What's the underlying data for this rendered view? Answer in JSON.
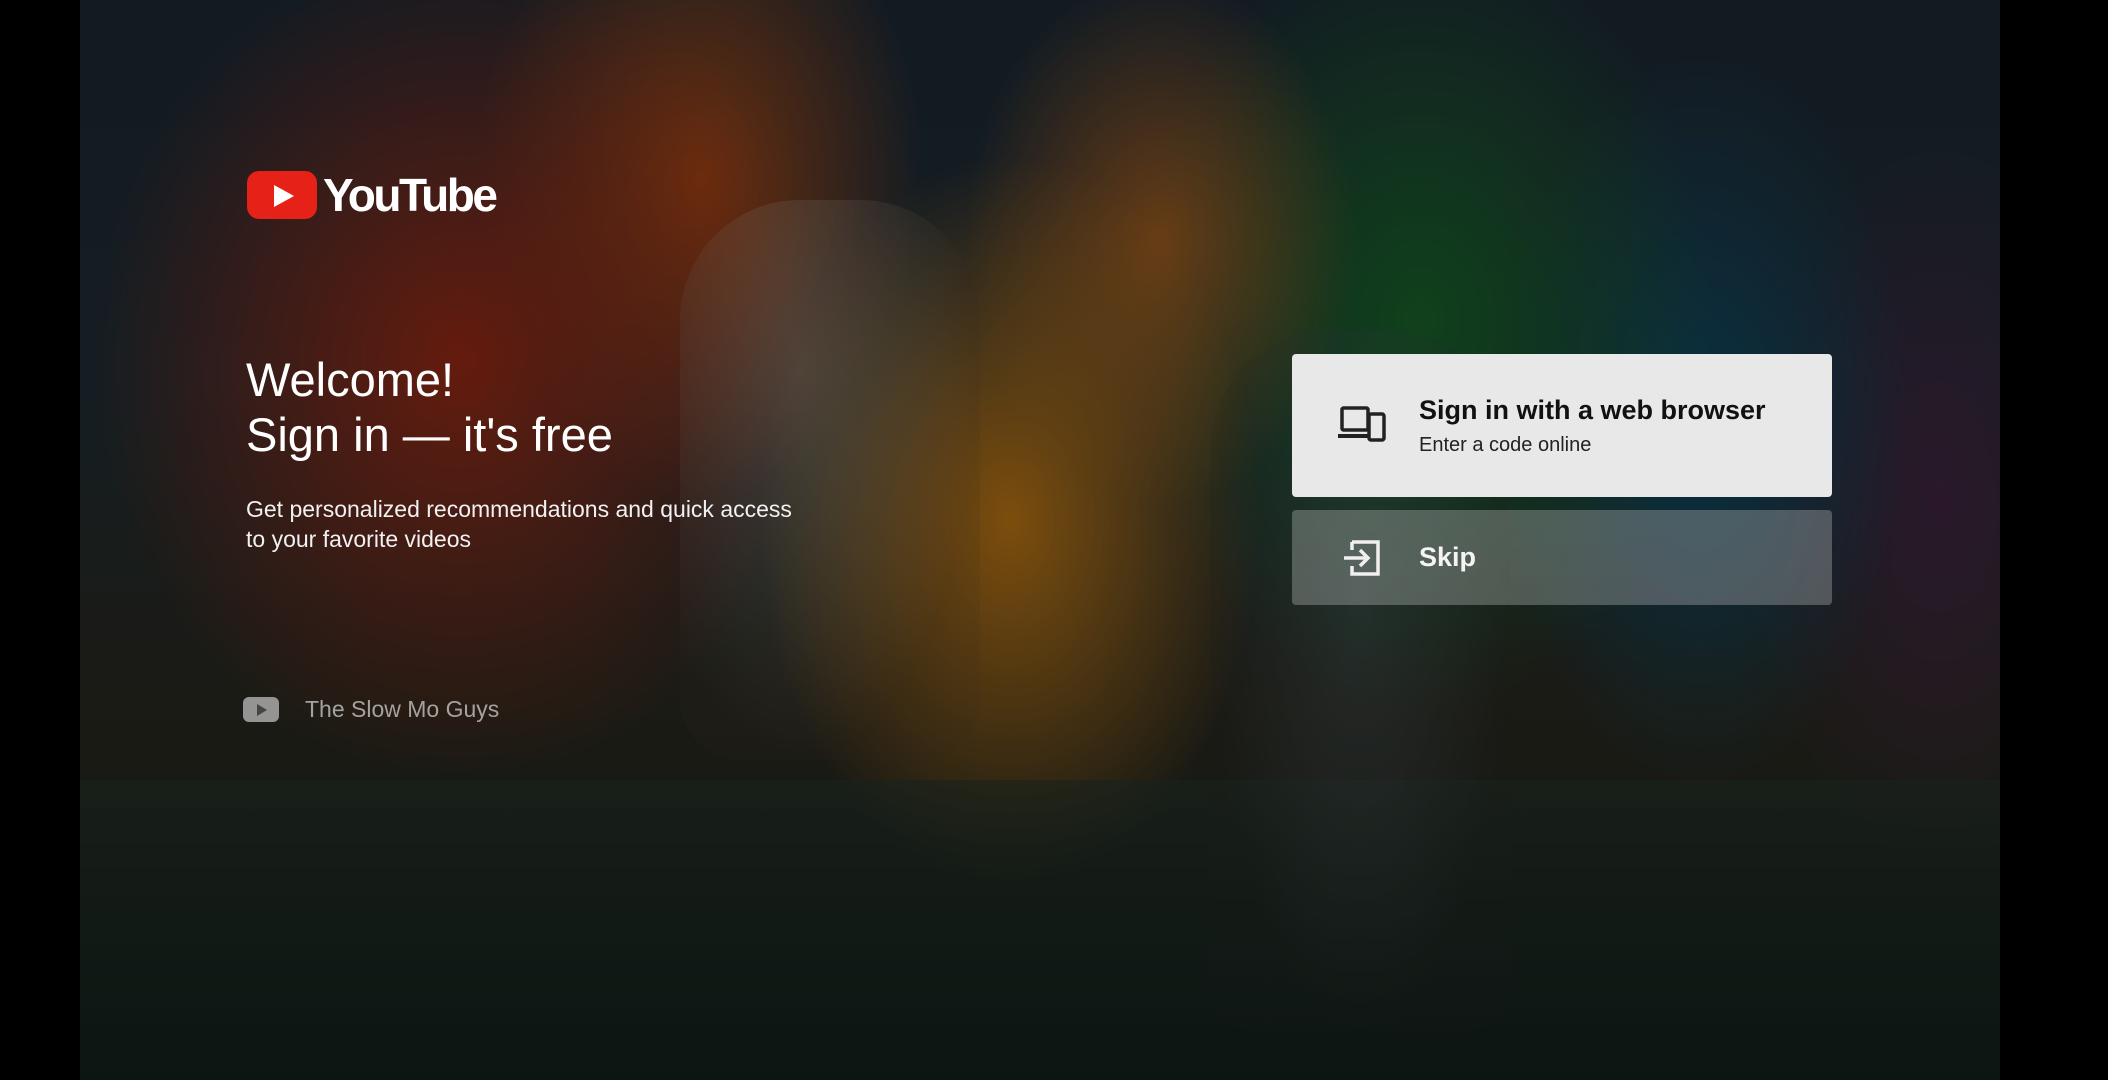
{
  "brand": {
    "logo_text": "YouTube",
    "logo_color": "#e62117"
  },
  "welcome": {
    "line1": "Welcome!",
    "line2": "Sign in — it's free",
    "subtitle": "Get personalized recommendations and quick access to your favorite videos"
  },
  "attribution": {
    "channel_name": "The Slow Mo Guys",
    "icon": "youtube-play-icon"
  },
  "options": {
    "signin_browser": {
      "title": "Sign in with a web browser",
      "subtitle": "Enter a code online",
      "icon": "devices-icon",
      "state": "focused"
    },
    "skip": {
      "title": "Skip",
      "icon": "exit-to-app-icon"
    }
  }
}
